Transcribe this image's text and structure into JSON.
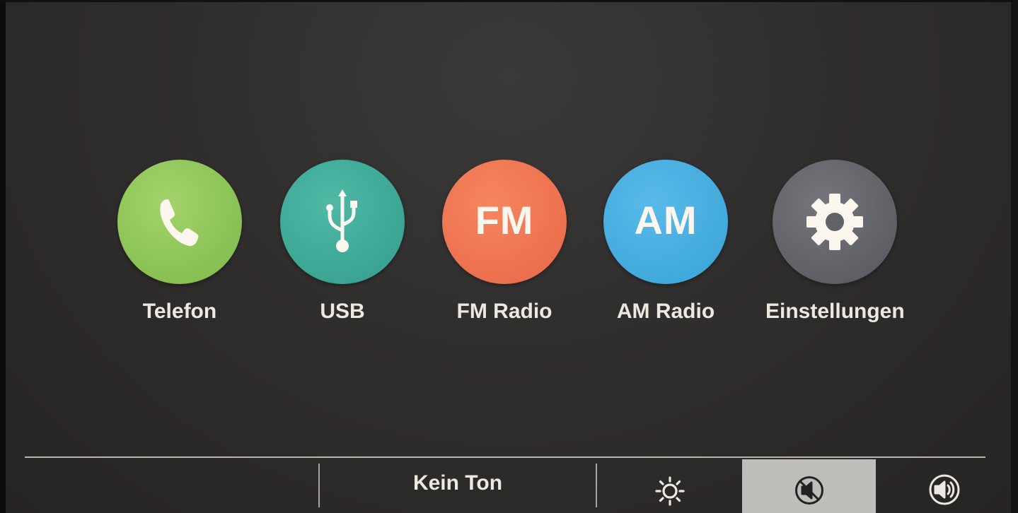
{
  "apps": [
    {
      "label": "Telefon",
      "icon": "phone-icon",
      "color": "#8cc357"
    },
    {
      "label": "USB",
      "icon": "usb-icon",
      "color": "#3ea897"
    },
    {
      "label": "FM Radio",
      "icon_text": "FM",
      "color": "#ee7350"
    },
    {
      "label": "AM Radio",
      "icon_text": "AM",
      "color": "#45acde"
    },
    {
      "label": "Einstellungen",
      "icon": "gear-icon",
      "color": "#616369"
    }
  ],
  "status_bar": {
    "status_text": "Kein Ton",
    "controls": [
      {
        "icon": "brightness-icon",
        "active": false
      },
      {
        "icon": "mute-icon",
        "active": true
      },
      {
        "icon": "volume-icon",
        "active": false
      }
    ]
  },
  "colors": {
    "background": "#302d2d",
    "text": "#ede8e0",
    "active_control": "#bebdba"
  }
}
